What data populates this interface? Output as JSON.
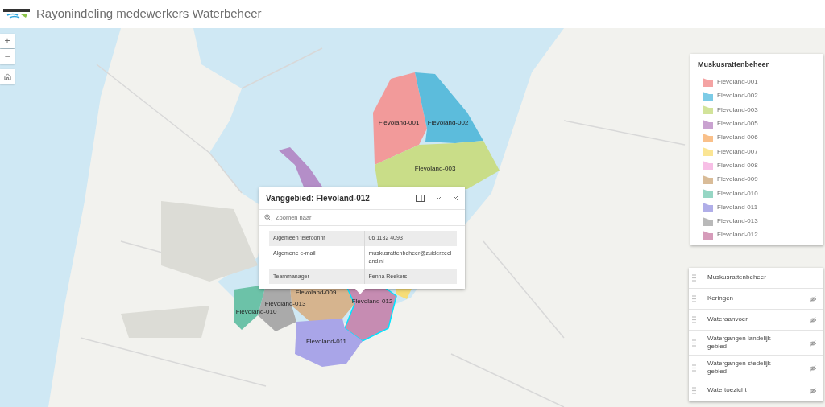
{
  "header": {
    "title": "Rayonindeling medewerkers Waterbeheer"
  },
  "map_controls": {
    "zoom_in": "+",
    "zoom_out": "−"
  },
  "map": {
    "areas": [
      {
        "label": "Flevoland-001",
        "color": "#f29a9a",
        "selected": false
      },
      {
        "label": "Flevoland-002",
        "color": "#5cbcdc",
        "selected": false
      },
      {
        "label": "Flevoland-003",
        "color": "#c9dd88",
        "selected": false
      },
      {
        "label": "Flevoland-009",
        "color": "#d6b48e",
        "selected": false
      },
      {
        "label": "Flevoland-012",
        "color": "#c68cb2",
        "selected": true
      },
      {
        "label": "Flevoland-013",
        "color": "#aaaaaa",
        "selected": false
      },
      {
        "label": "Flevoland-010",
        "color": "#6cc2a8",
        "selected": false
      },
      {
        "label": "Flevoland-011",
        "color": "#a9a5e8",
        "selected": false
      }
    ]
  },
  "popup": {
    "title": "Vanggebied: Flevoland-012",
    "zoom_link": "Zoomen naar",
    "rows": [
      {
        "field": "Algemeen telefoonnr",
        "value": "06 1132 4093"
      },
      {
        "field": "Algemene e-mail",
        "value": "muskusrattenbeheer@zuiderzeeland.nl"
      },
      {
        "field": "Teammanager",
        "value": "Fenna Reekers"
      }
    ]
  },
  "legend": {
    "title": "Muskusrattenbeheer",
    "items": [
      {
        "label": "Flevoland-001",
        "color": "#f4a3a3"
      },
      {
        "label": "Flevoland-002",
        "color": "#7ccbe6"
      },
      {
        "label": "Flevoland-003",
        "color": "#d2e39a"
      },
      {
        "label": "Flevoland-005",
        "color": "#c9a2d0"
      },
      {
        "label": "Flevoland-006",
        "color": "#f9c08a"
      },
      {
        "label": "Flevoland-007",
        "color": "#fbe594"
      },
      {
        "label": "Flevoland-008",
        "color": "#f7bfe6"
      },
      {
        "label": "Flevoland-009",
        "color": "#d9bc98"
      },
      {
        "label": "Flevoland-010",
        "color": "#96d6c4"
      },
      {
        "label": "Flevoland-011",
        "color": "#b0aee8"
      },
      {
        "label": "Flevoland-013",
        "color": "#b9b9b9"
      },
      {
        "label": "Flevoland-012",
        "color": "#d69cba"
      }
    ]
  },
  "layers": [
    {
      "label": "Muskusrattenbeheer",
      "visible": true
    },
    {
      "label": "Keringen",
      "visible": false
    },
    {
      "label": "Wateraanvoer",
      "visible": false
    },
    {
      "label": "Watergangen landelijk gebied",
      "visible": false
    },
    {
      "label": "Watergangen stedelijk gebied",
      "visible": false
    },
    {
      "label": "Watertoezicht",
      "visible": false
    }
  ]
}
